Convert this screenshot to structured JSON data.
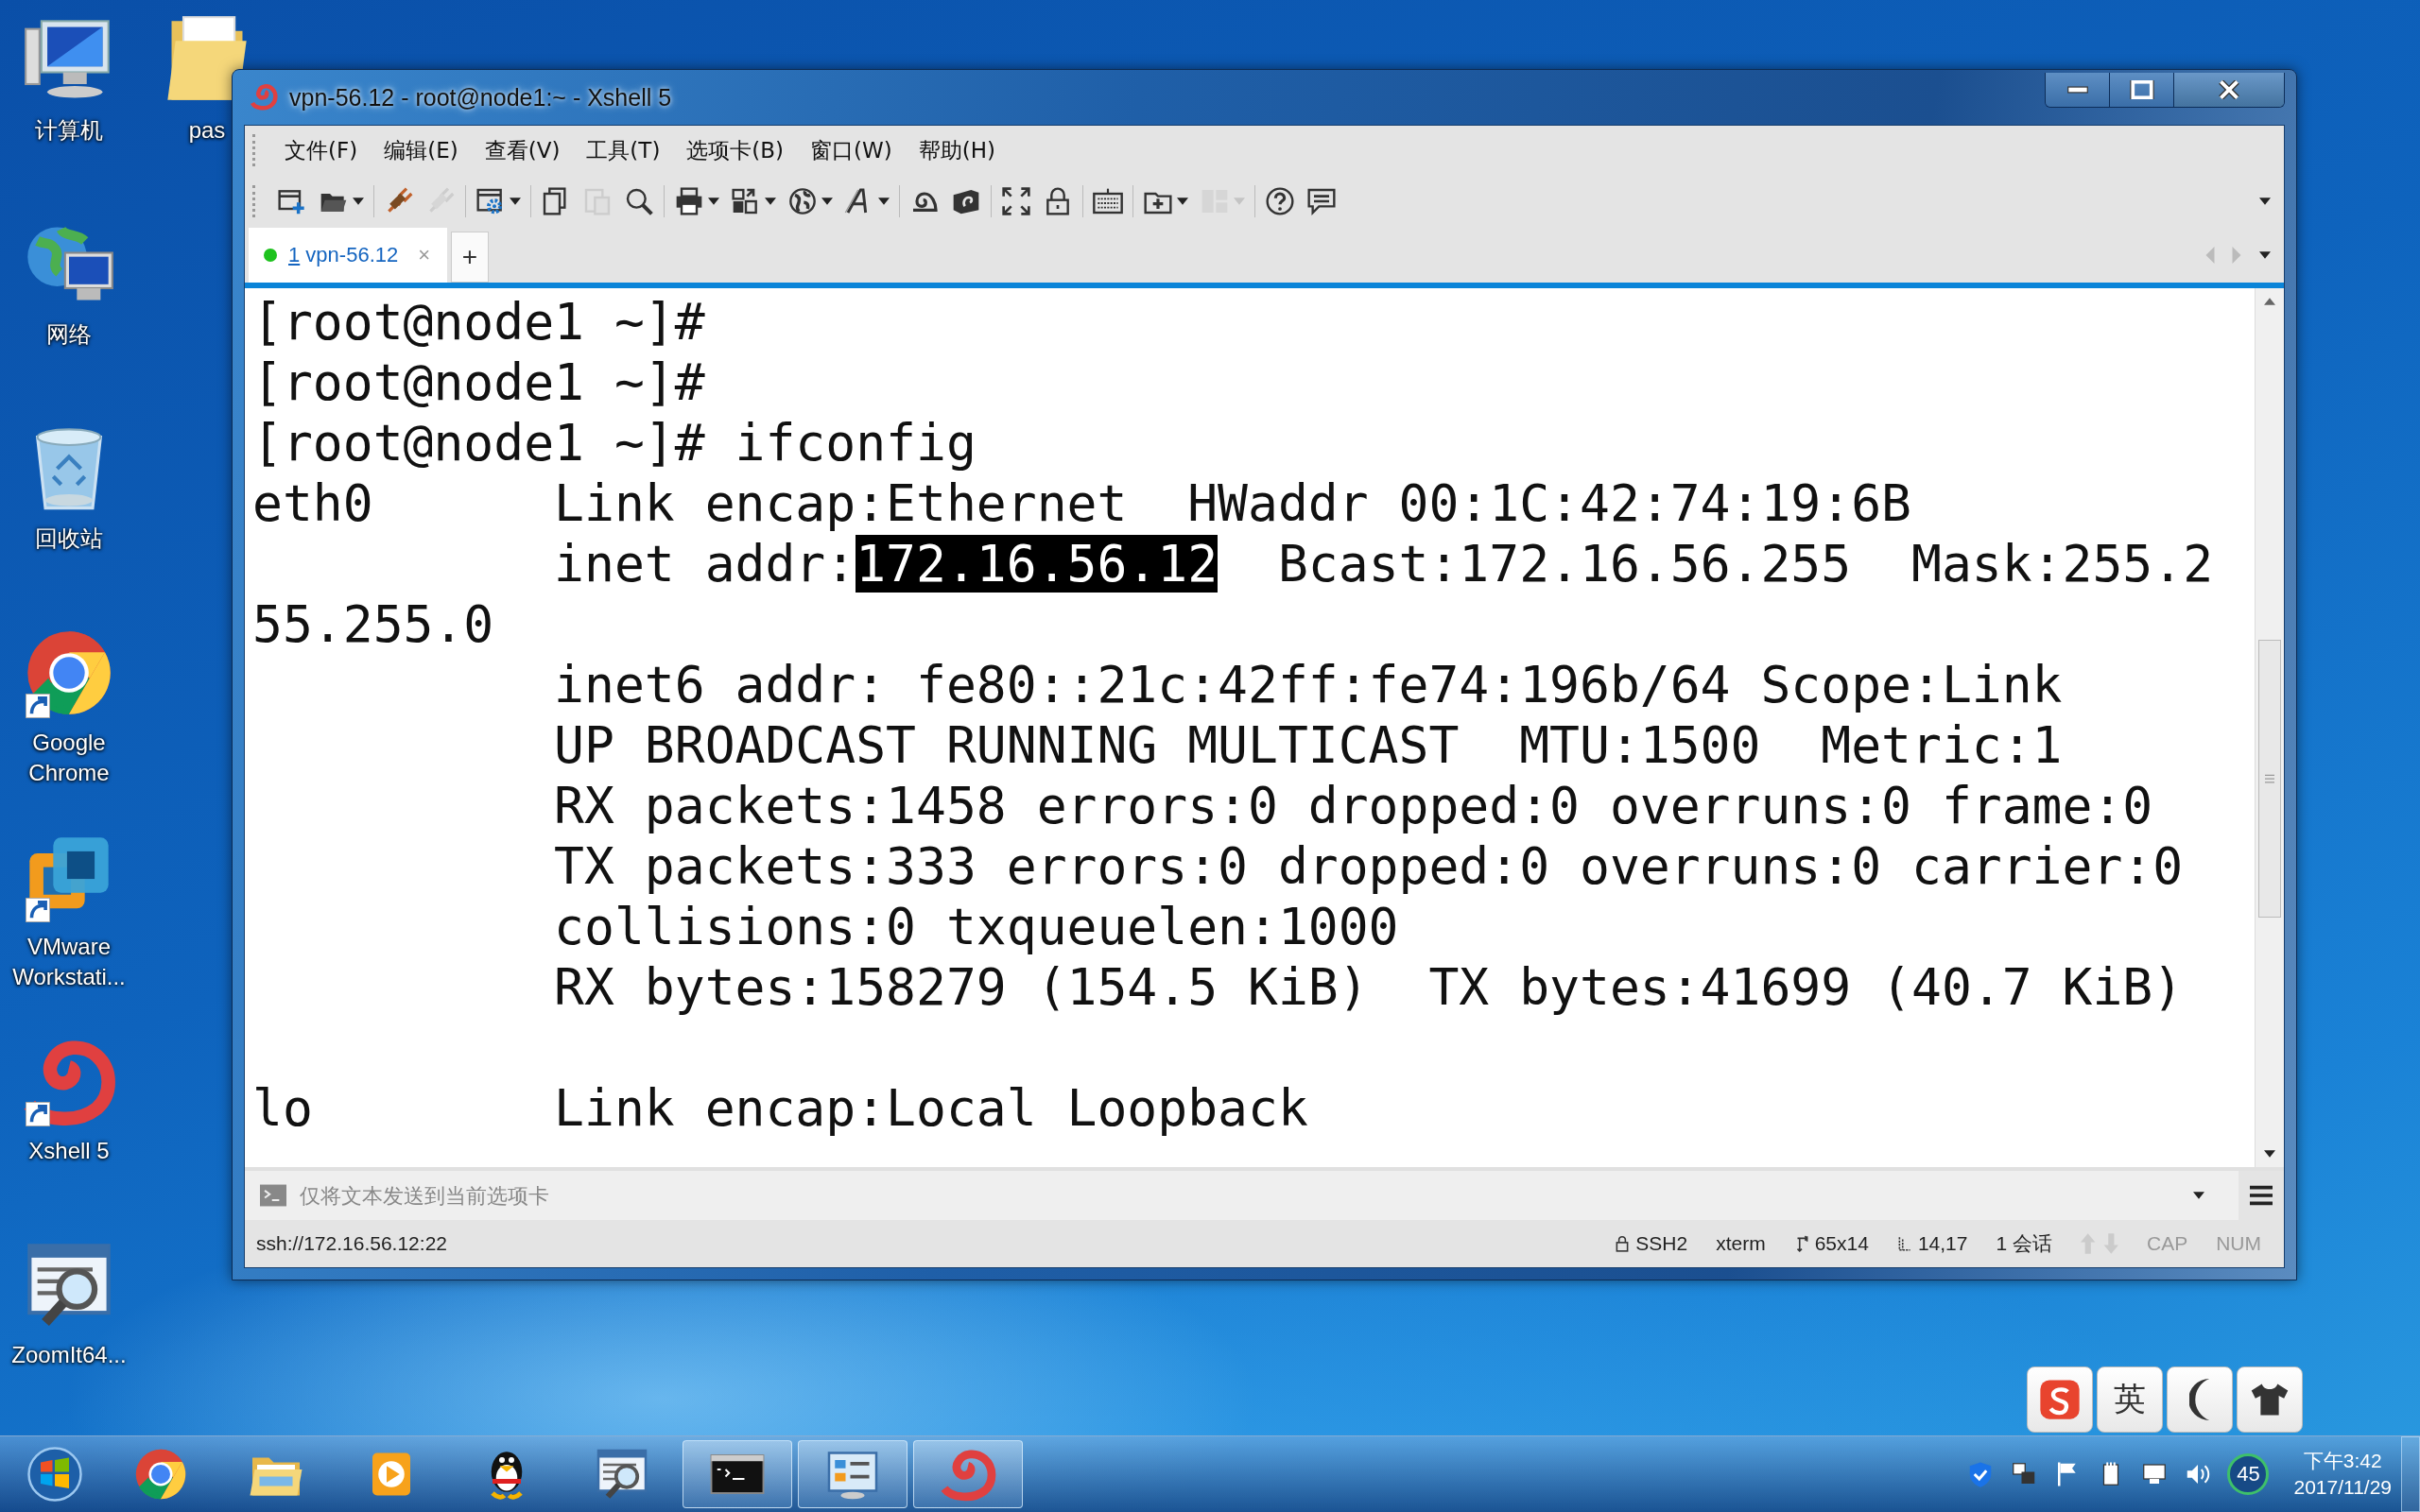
{
  "desktop": {
    "icons": [
      {
        "kind": "computer",
        "label": "计算机",
        "shortcut": false
      },
      {
        "kind": "network",
        "label": "网络",
        "shortcut": false
      },
      {
        "kind": "recycle-bin",
        "label": "回收站",
        "shortcut": false
      },
      {
        "kind": "chrome",
        "label": "Google Chrome",
        "shortcut": true
      },
      {
        "kind": "vmware",
        "label": "VMware Workstati...",
        "shortcut": true
      },
      {
        "kind": "xshell",
        "label": "Xshell 5",
        "shortcut": true
      },
      {
        "kind": "zoomit",
        "label": "ZoomIt64...",
        "shortcut": false
      },
      {
        "kind": "folder",
        "label": "pas",
        "shortcut": false
      }
    ]
  },
  "window": {
    "title": "vpn-56.12 - root@node1:~ - Xshell 5",
    "menu": [
      "文件(F)",
      "编辑(E)",
      "查看(V)",
      "工具(T)",
      "选项卡(B)",
      "窗口(W)",
      "帮助(H)"
    ],
    "toolbar": [
      {
        "kind": "new-session",
        "disabled": false,
        "dropdown": false
      },
      {
        "kind": "open",
        "disabled": false,
        "dropdown": true
      },
      {
        "kind": "separator"
      },
      {
        "kind": "connect",
        "disabled": false,
        "dropdown": false
      },
      {
        "kind": "disconnect",
        "disabled": true,
        "dropdown": false
      },
      {
        "kind": "separator"
      },
      {
        "kind": "properties",
        "disabled": false,
        "dropdown": true
      },
      {
        "kind": "separator"
      },
      {
        "kind": "copy",
        "disabled": false,
        "dropdown": false
      },
      {
        "kind": "paste",
        "disabled": true,
        "dropdown": false
      },
      {
        "kind": "find",
        "disabled": false,
        "dropdown": false
      },
      {
        "kind": "separator"
      },
      {
        "kind": "print",
        "disabled": false,
        "dropdown": true
      },
      {
        "kind": "transfer",
        "disabled": false,
        "dropdown": true
      },
      {
        "kind": "globe",
        "disabled": false,
        "dropdown": true
      },
      {
        "kind": "font",
        "disabled": false,
        "dropdown": true
      },
      {
        "kind": "separator"
      },
      {
        "kind": "swirl",
        "disabled": false,
        "dropdown": false
      },
      {
        "kind": "folder-swirl",
        "disabled": false,
        "dropdown": false
      },
      {
        "kind": "separator"
      },
      {
        "kind": "fullscreen",
        "disabled": false,
        "dropdown": false
      },
      {
        "kind": "lock",
        "disabled": false,
        "dropdown": false
      },
      {
        "kind": "separator"
      },
      {
        "kind": "keyboard",
        "disabled": false,
        "dropdown": false
      },
      {
        "kind": "separator"
      },
      {
        "kind": "add",
        "disabled": false,
        "dropdown": true
      },
      {
        "kind": "layout",
        "disabled": true,
        "dropdown": true
      },
      {
        "kind": "separator"
      },
      {
        "kind": "help",
        "disabled": false,
        "dropdown": false
      },
      {
        "kind": "chat",
        "disabled": false,
        "dropdown": false
      }
    ],
    "tabs": [
      {
        "number": "1",
        "label": "vpn-56.12",
        "selected": true,
        "connected": true,
        "close": "×"
      }
    ],
    "new_tab": "+",
    "terminal": {
      "lines": [
        {
          "segments": [
            {
              "text": "[root@node1 ~]#",
              "selected": false
            }
          ]
        },
        {
          "segments": [
            {
              "text": "[root@node1 ~]#",
              "selected": false
            }
          ]
        },
        {
          "segments": [
            {
              "text": "[root@node1 ~]# ifconfig",
              "selected": false
            }
          ]
        },
        {
          "segments": [
            {
              "text": "eth0      Link encap:Ethernet  HWaddr 00:1C:42:74:19:6B",
              "selected": false
            }
          ]
        },
        {
          "segments": [
            {
              "text": "          inet addr:",
              "selected": false
            },
            {
              "text": "172.16.56.12",
              "selected": true
            },
            {
              "text": "  Bcast:172.16.56.255  Mask:255.2",
              "selected": false
            }
          ]
        },
        {
          "segments": [
            {
              "text": "55.255.0",
              "selected": false
            }
          ]
        },
        {
          "segments": [
            {
              "text": "          inet6 addr: fe80::21c:42ff:fe74:196b/64 Scope:Link",
              "selected": false
            }
          ]
        },
        {
          "segments": [
            {
              "text": "          UP BROADCAST RUNNING MULTICAST  MTU:1500  Metric:1",
              "selected": false
            }
          ]
        },
        {
          "segments": [
            {
              "text": "          RX packets:1458 errors:0 dropped:0 overruns:0 frame:0",
              "selected": false
            }
          ]
        },
        {
          "segments": [
            {
              "text": "          TX packets:333 errors:0 dropped:0 overruns:0 carrier:0",
              "selected": false
            }
          ]
        },
        {
          "segments": [
            {
              "text": "          collisions:0 txqueuelen:1000",
              "selected": false
            }
          ]
        },
        {
          "segments": [
            {
              "text": "          RX bytes:158279 (154.5 KiB)  TX bytes:41699 (40.7 KiB)",
              "selected": false
            }
          ]
        },
        {
          "blank_before": true,
          "segments": [
            {
              "text": "lo        Link encap:Local Loopback",
              "selected": false
            }
          ]
        }
      ]
    },
    "send_bar": {
      "placeholder": "仅将文本发送到当前选项卡"
    },
    "status_bar": {
      "address": "ssh://172.16.56.12:22",
      "items": [
        {
          "kind": "lock",
          "text": "SSH2",
          "on": true
        },
        {
          "kind": "plain",
          "text": "xterm",
          "on": true
        },
        {
          "kind": "size",
          "text": "65x14",
          "on": true
        },
        {
          "kind": "cursor",
          "text": "14,17",
          "on": true
        },
        {
          "kind": "plain",
          "text": "1 会话",
          "on": true
        },
        {
          "kind": "arrows",
          "on": false
        },
        {
          "kind": "plain",
          "text": "CAP",
          "on": false
        },
        {
          "kind": "plain",
          "text": "NUM",
          "on": false
        }
      ]
    }
  },
  "ime_bar": [
    {
      "kind": "sogou"
    },
    {
      "kind": "text",
      "text": "英"
    },
    {
      "kind": "moon"
    },
    {
      "kind": "shirt"
    }
  ],
  "taskbar": {
    "items": [
      {
        "kind": "start",
        "active": false
      },
      {
        "kind": "chrome",
        "active": false
      },
      {
        "kind": "explorer",
        "active": false
      },
      {
        "kind": "media",
        "active": false
      },
      {
        "kind": "penguin",
        "active": false
      },
      {
        "kind": "zoomit",
        "active": false
      },
      {
        "kind": "cmd",
        "active": true
      },
      {
        "kind": "panel",
        "active": true
      },
      {
        "kind": "xshell",
        "active": true
      }
    ],
    "tray": {
      "badge": "45",
      "time": "下午3:42",
      "date": "2017/11/29"
    }
  }
}
